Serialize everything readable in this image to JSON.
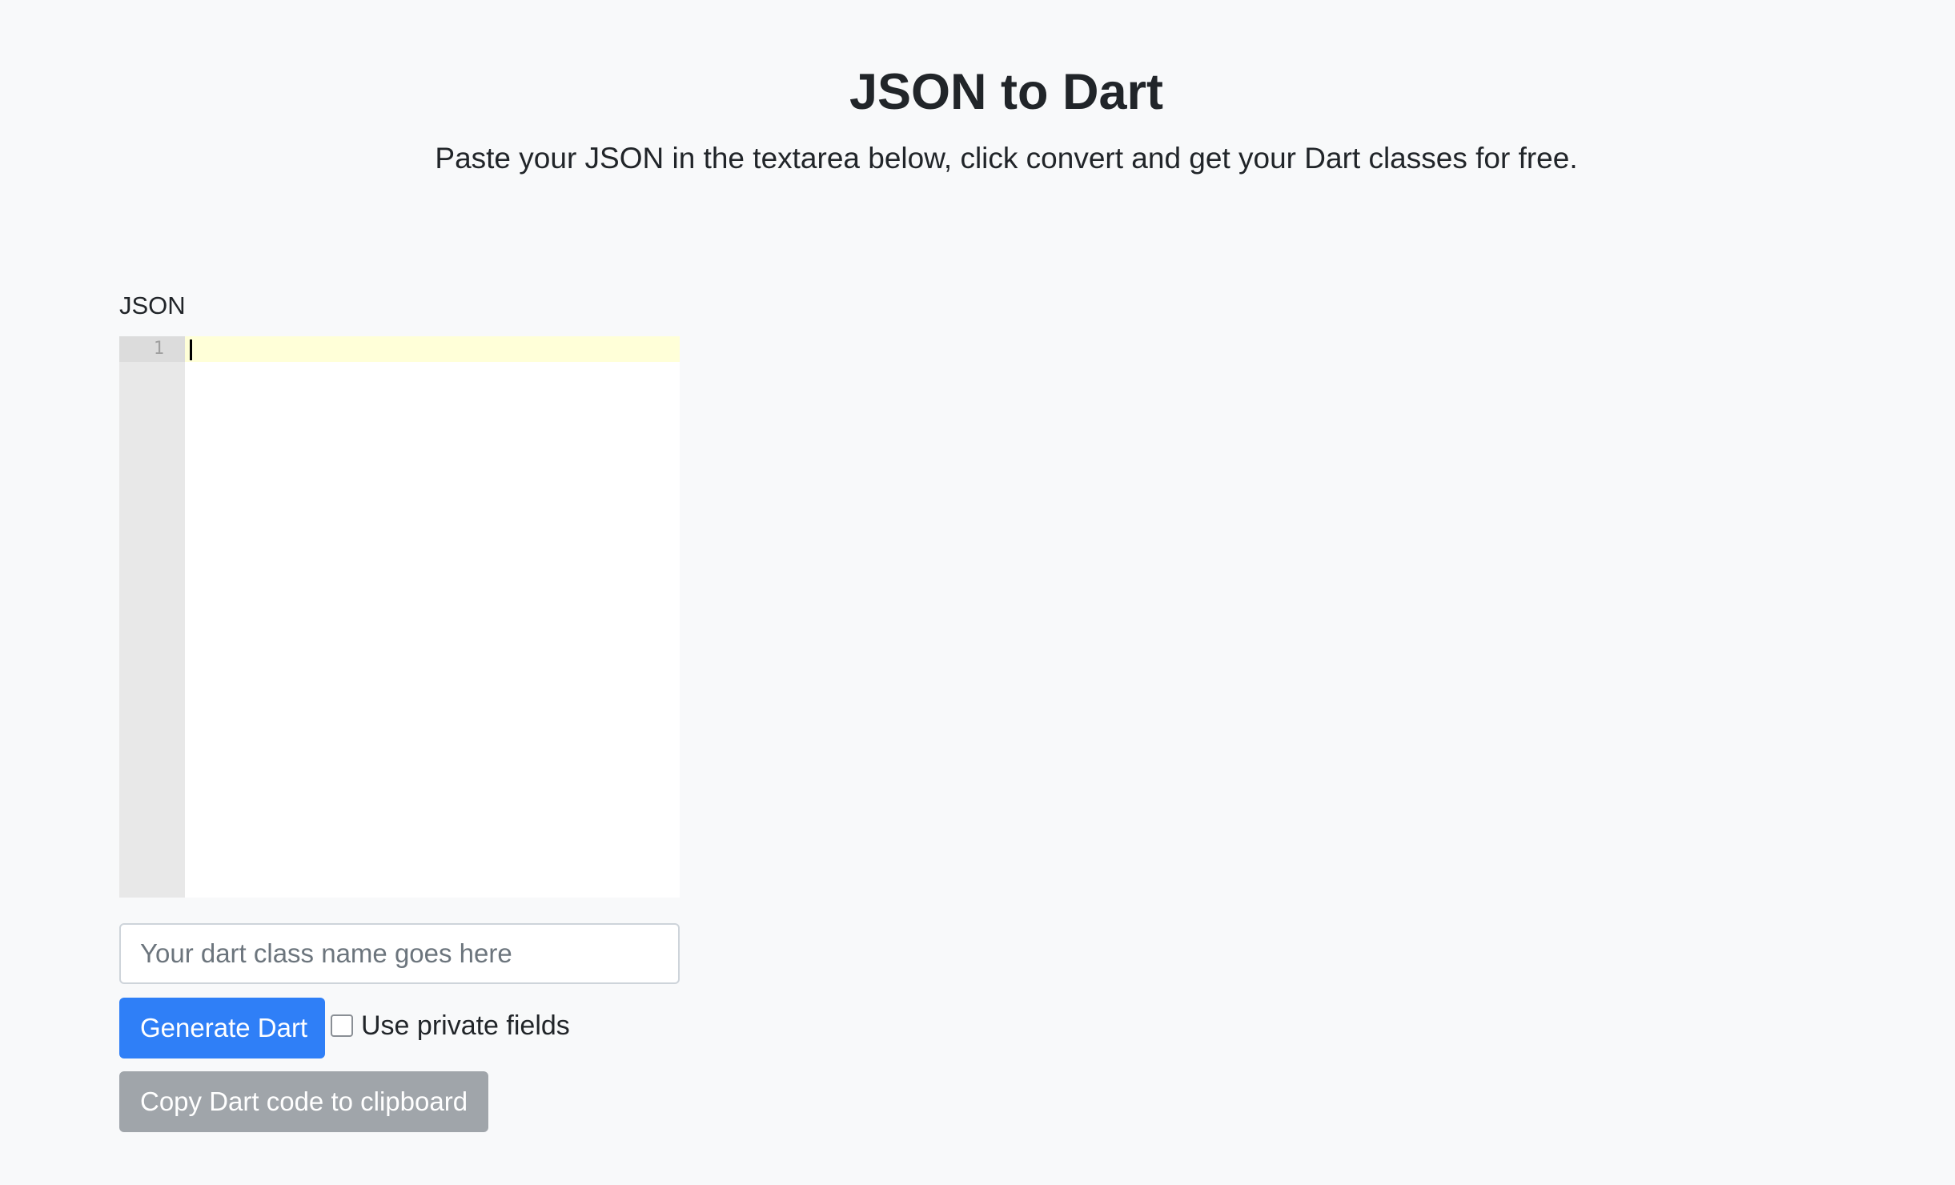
{
  "header": {
    "title": "JSON to Dart",
    "subtitle": "Paste your JSON in the textarea below, click convert and get your Dart classes for free."
  },
  "editor": {
    "label": "JSON",
    "line_number": "1"
  },
  "form": {
    "class_name_placeholder": "Your dart class name goes here",
    "class_name_value": "",
    "generate_button": "Generate Dart",
    "private_fields_label": "Use private fields",
    "private_fields_checked": false,
    "copy_button": "Copy Dart code to clipboard"
  },
  "colors": {
    "primary": "#2f7ff7",
    "secondary": "#a0a5aa",
    "active_line": "#ffffd8",
    "background": "#f8f9fa"
  }
}
